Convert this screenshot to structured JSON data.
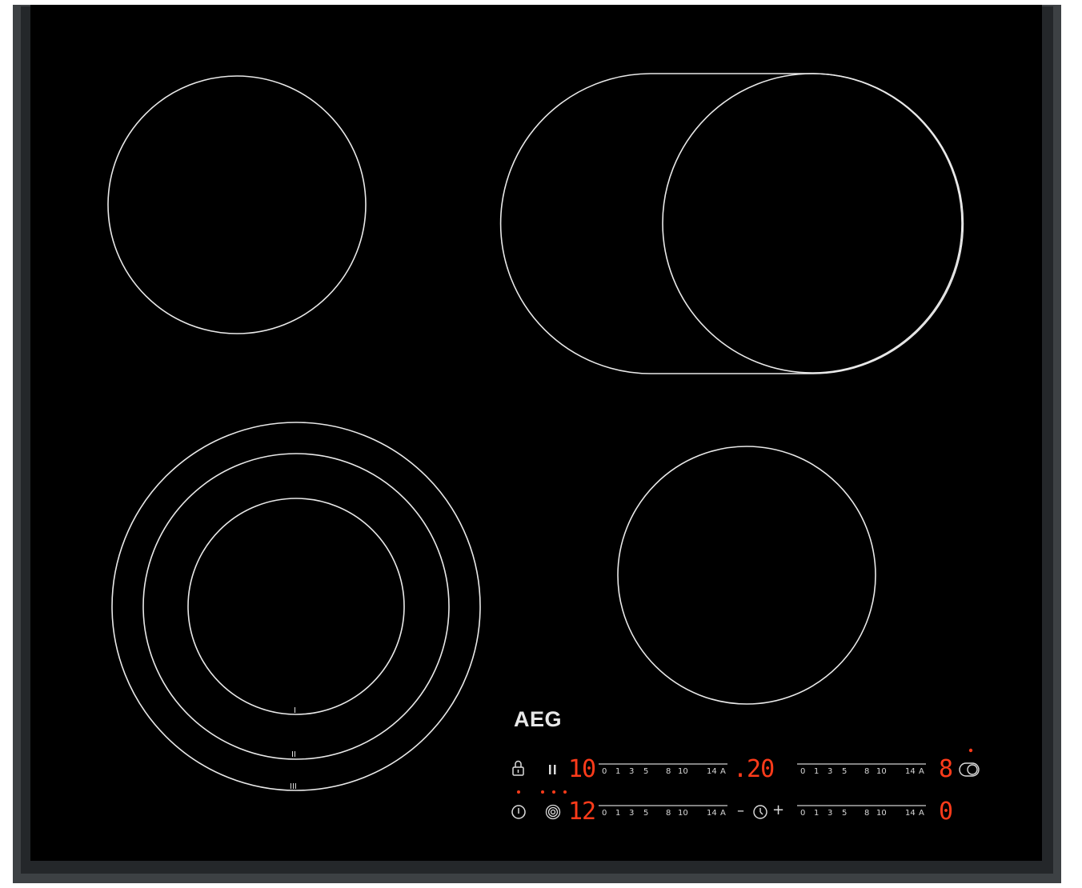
{
  "brand": "AEG",
  "colors": {
    "glass": "#000000",
    "frame": "#3d4144",
    "zone_outline": "#e9e9e9",
    "display_red": "#ff3b1a",
    "print_white": "#dcdcdc"
  },
  "zone_marks": {
    "inner": "I",
    "middle": "II",
    "outer": "III"
  },
  "controls": {
    "displays": {
      "front_left_level": "10",
      "timer_value": ".20",
      "rear_right_level": "8",
      "rear_left_level": "12",
      "front_right_level": "0"
    },
    "slider_scale": [
      "0",
      "1",
      "3",
      "5",
      "8",
      "10",
      "14",
      "A"
    ],
    "timer_minus": "–",
    "timer_plus": "+",
    "icons": {
      "lock": "lock-icon",
      "pause": "pause-icon",
      "power": "power-icon",
      "triple_zone": "triple-zone-icon",
      "timer": "timer-icon",
      "bridge": "bridge-zone-icon"
    }
  }
}
